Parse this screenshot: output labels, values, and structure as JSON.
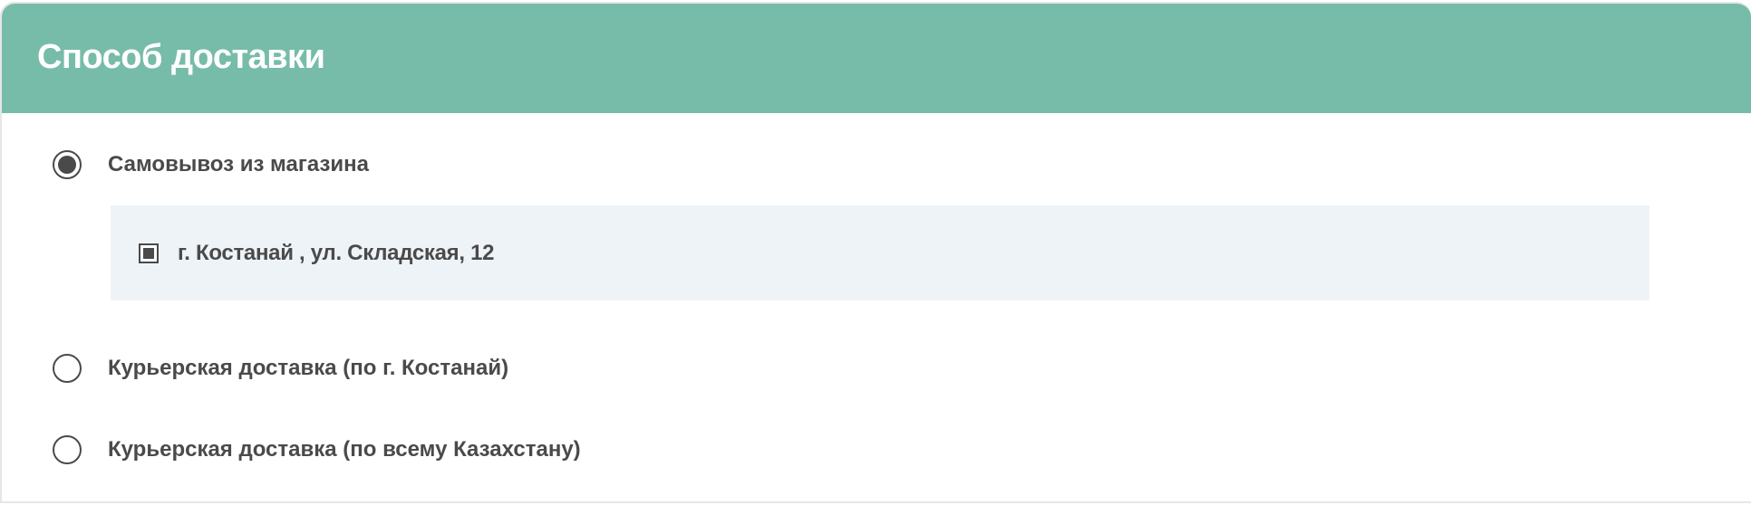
{
  "header": {
    "title": "Способ доставки"
  },
  "delivery_options": [
    {
      "label": "Самовывоз из магазина",
      "selected": true
    },
    {
      "label": "Курьерская доставка (по г. Костанай)",
      "selected": false
    },
    {
      "label": "Курьерская доставка (по всему Казахстану)",
      "selected": false
    }
  ],
  "pickup_stores": [
    {
      "label": "г. Костанай , ул. Складская, 12",
      "checked": true
    }
  ],
  "colors": {
    "header_bg": "#77bca9",
    "header_text": "#ffffff",
    "text": "#4a4a4a",
    "store_box_bg": "#eef3f8"
  }
}
